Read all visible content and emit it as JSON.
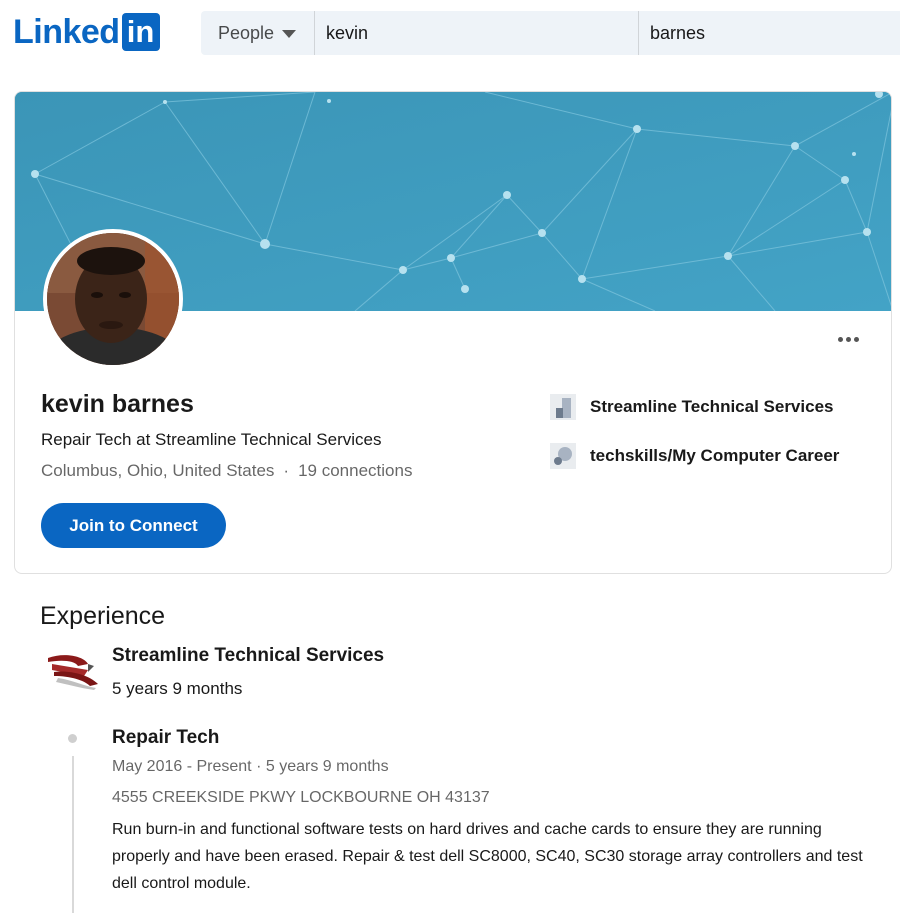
{
  "header": {
    "logo_text": "Linked",
    "logo_box": "in",
    "search_type": "People",
    "first_name": "kevin",
    "last_name": "barnes"
  },
  "profile": {
    "name": "kevin barnes",
    "headline": "Repair Tech at Streamline Technical Services",
    "location": "Columbus, Ohio, United States",
    "separator": "·",
    "connections": "19 connections",
    "join_label": "Join to Connect",
    "organizations": [
      {
        "name": "Streamline Technical Services"
      },
      {
        "name": "techskills/My Computer Career"
      }
    ]
  },
  "experience": {
    "title": "Experience",
    "company": "Streamline Technical Services",
    "company_duration": "5 years 9 months",
    "role": {
      "title": "Repair Tech",
      "dates": "May 2016 - Present · 5 years 9 months",
      "address": "4555 CREEKSIDE PKWY LOCKBOURNE OH 43137",
      "description": "Run burn-in and functional software tests on hard drives and cache cards to ensure they are running properly and have been erased. Repair & test dell SC8000, SC40, SC30 storage array controllers and test dell control module."
    }
  },
  "colors": {
    "brand": "#0a66c2",
    "banner": "#3d9bbd"
  }
}
